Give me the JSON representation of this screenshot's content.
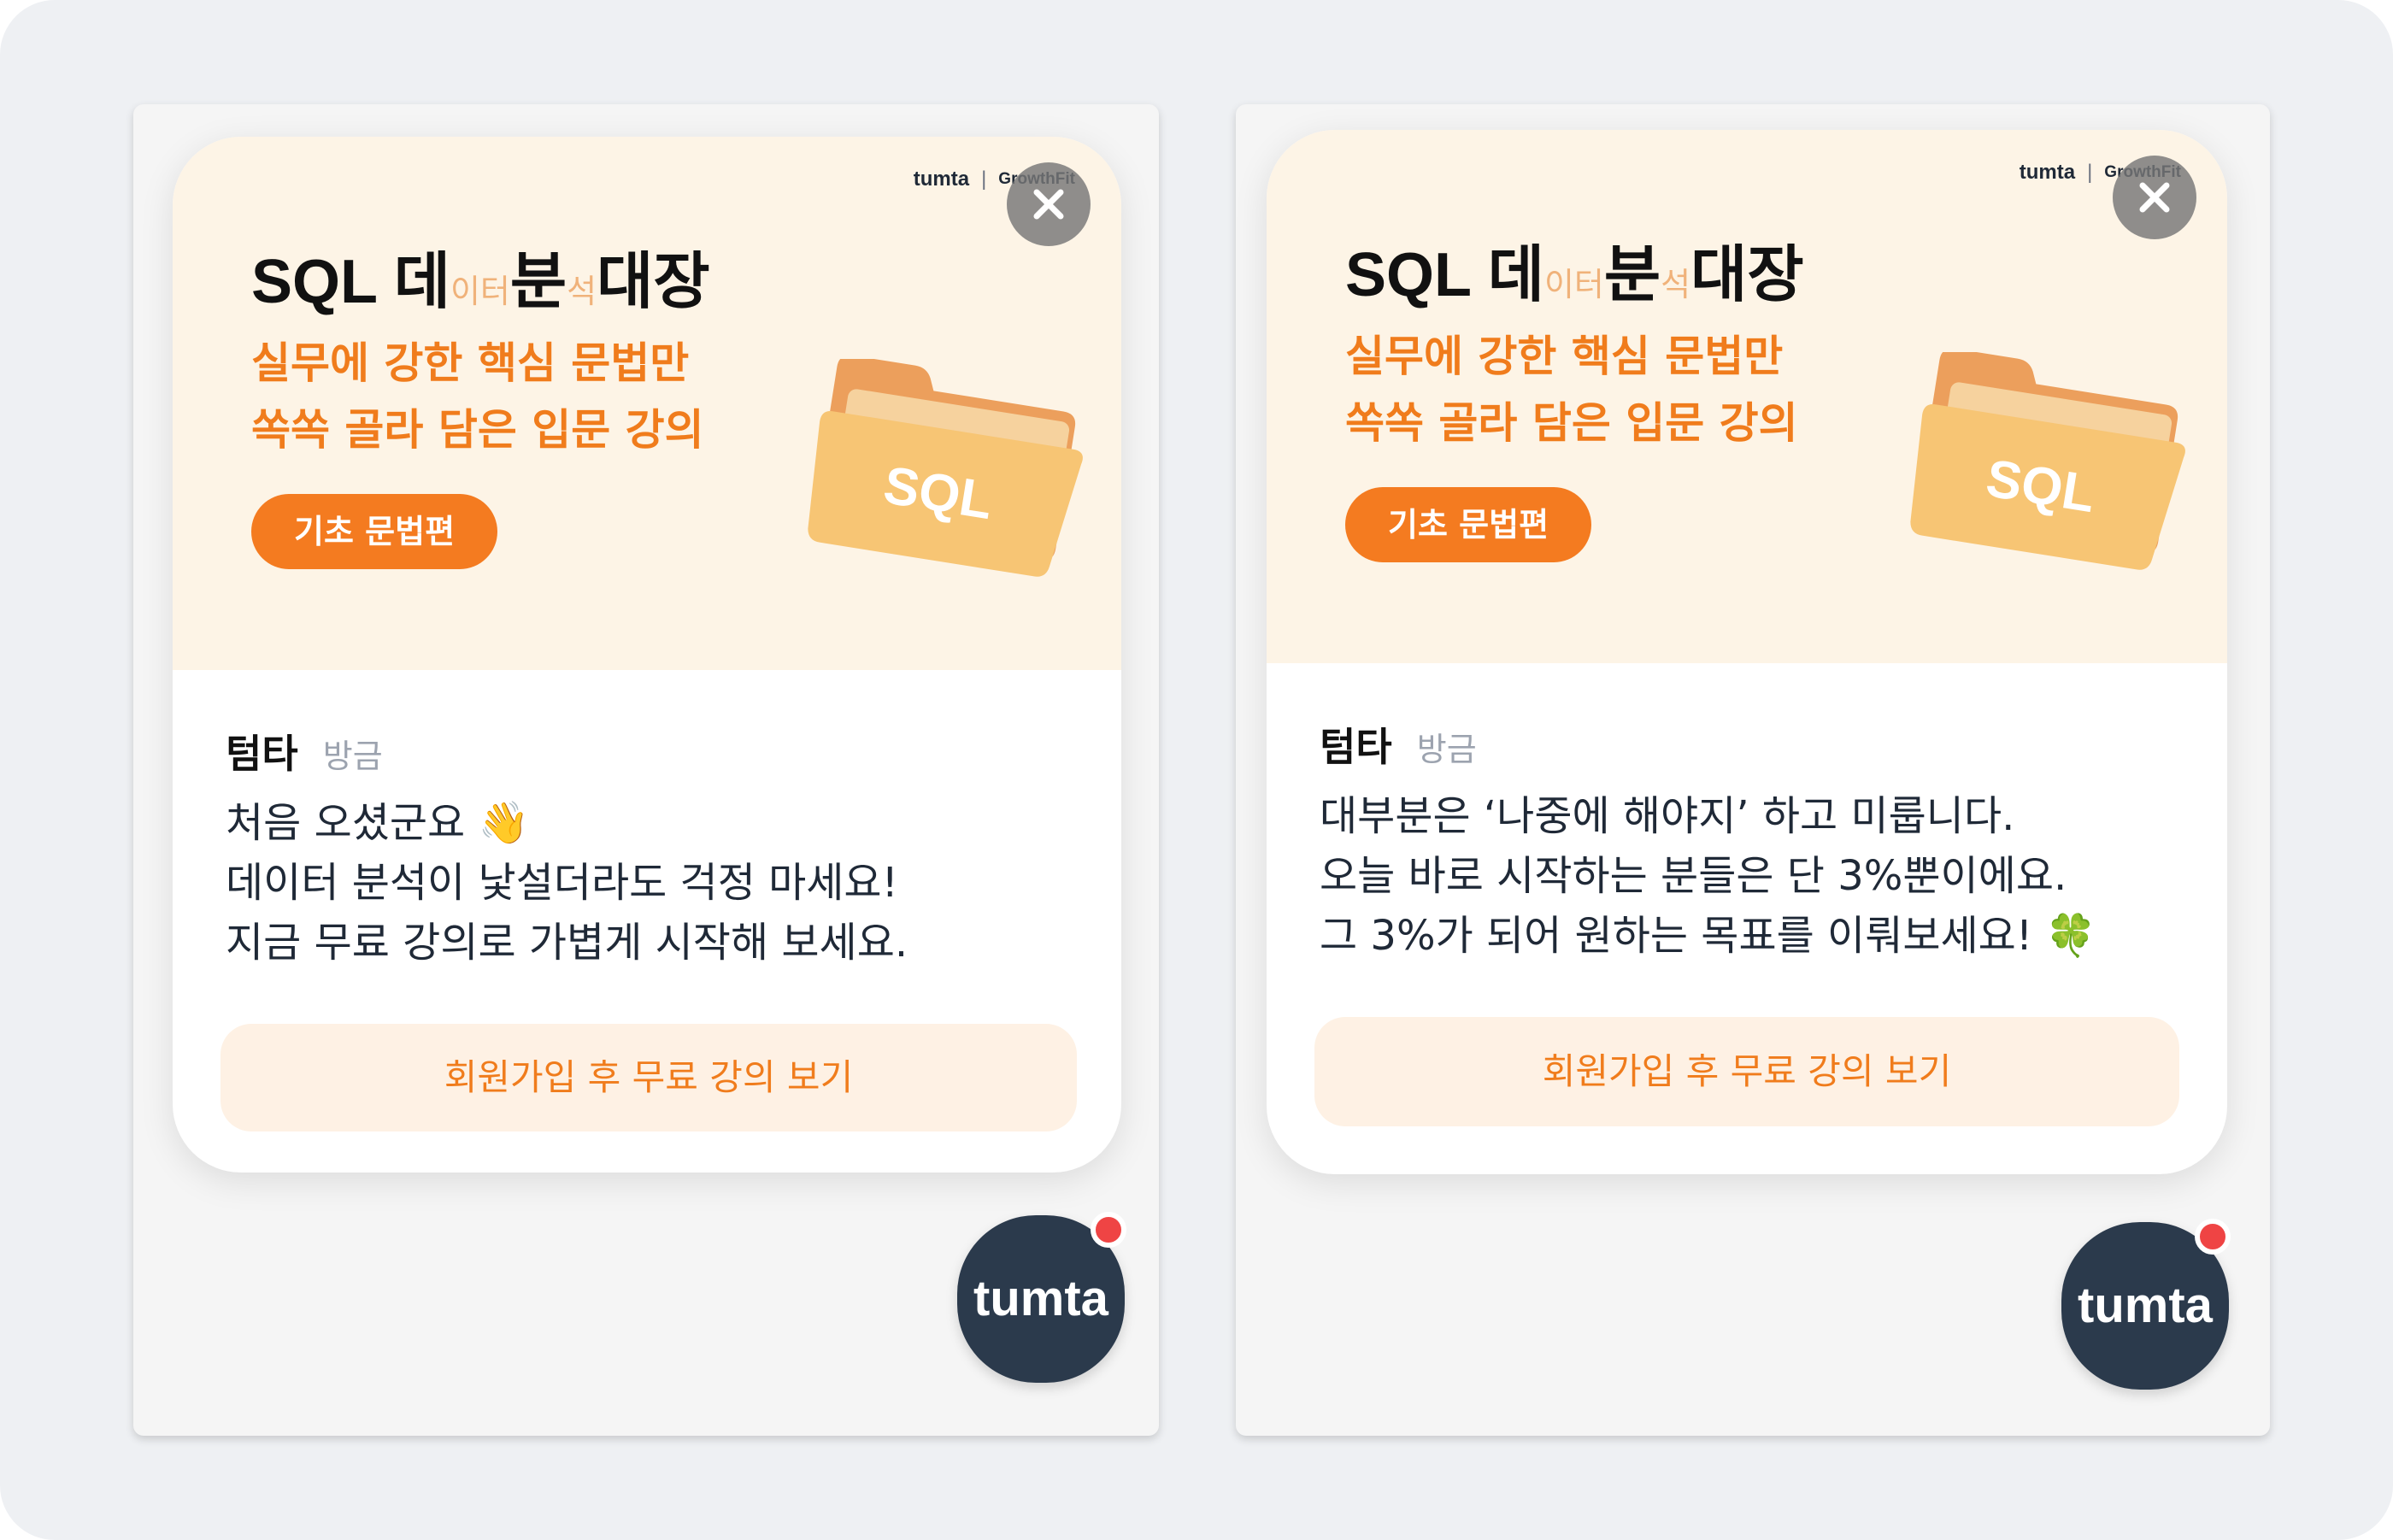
{
  "panels": [
    {
      "banner": {
        "brand": "tumta",
        "brand_separator": "|",
        "brand_partner": "GrowthFit",
        "title_prefix": "SQL 데",
        "title_small_1": "이터",
        "title_mid": "분",
        "title_small_2": "석",
        "title_suffix": "대장",
        "subtitle_lines": [
          "실무에 강한 핵심 문법만",
          "쏙쏙 골라 담은 입문 강의"
        ],
        "tag": "기초 문법편",
        "folder_label": "SQL",
        "close_icon": "close-icon"
      },
      "message": {
        "sender": "텀타",
        "time": "방금",
        "lines": [
          "처음 오셨군요 👋",
          "데이터 분석이 낯설더라도 걱정 마세요!",
          "지금 무료 강의로 가볍게 시작해 보세요."
        ]
      },
      "cta": "회원가입 후 무료 강의 보기",
      "fab": {
        "label": "tumta",
        "has_notification": true
      }
    },
    {
      "banner": {
        "brand": "tumta",
        "brand_separator": "|",
        "brand_partner": "GrowthFit",
        "title_prefix": "SQL 데",
        "title_small_1": "이터",
        "title_mid": "분",
        "title_small_2": "석",
        "title_suffix": "대장",
        "subtitle_lines": [
          "실무에 강한 핵심 문법만",
          "쏙쏙 골라 담은 입문 강의"
        ],
        "tag": "기초 문법편",
        "folder_label": "SQL",
        "close_icon": "close-icon"
      },
      "message": {
        "sender": "텀타",
        "time": "방금",
        "lines": [
          "대부분은 ‘나중에 해야지’ 하고 미룹니다.",
          "오늘 바로 시작하는 분들은 단 3%뿐이에요.",
          "그 3%가 되어 원하는 목표를 이뤄보세요! 🍀"
        ]
      },
      "cta": "회원가입 후 무료 강의 보기",
      "fab": {
        "label": "tumta",
        "has_notification": true
      }
    }
  ],
  "colors": {
    "accent_orange": "#f47b20",
    "banner_bg": "#fdf4e6",
    "cta_bg": "#fef1e4",
    "fab_bg": "#2b3a4c",
    "notification_dot": "#ef4444"
  }
}
